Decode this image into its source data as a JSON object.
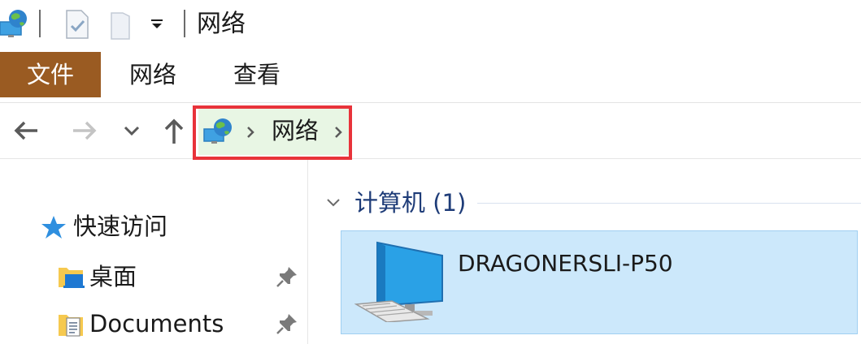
{
  "window": {
    "title": "网络"
  },
  "ribbon": {
    "tabs": [
      {
        "label": "文件"
      },
      {
        "label": "网络"
      },
      {
        "label": "查看"
      }
    ]
  },
  "address_bar": {
    "breadcrumbs": [
      "网络"
    ],
    "location_icon": "network-globe-icon"
  },
  "nav_pane": {
    "quick_access": {
      "label": "快速访问",
      "icon": "star-icon"
    },
    "items": [
      {
        "label": "桌面",
        "icon": "desktop-folder-icon",
        "pinned": true
      },
      {
        "label": "Documents",
        "icon": "documents-folder-icon",
        "pinned": true
      }
    ]
  },
  "content": {
    "group": {
      "label": "计算机 (1)",
      "expanded": true
    },
    "items": [
      {
        "name": "DRAGONERSLI-P50",
        "icon": "computer-monitor-icon",
        "selected": true
      }
    ]
  },
  "colors": {
    "file_tab": "#9a5b22",
    "selection": "#cce8fb",
    "group_label": "#1e3c78",
    "highlight_box": "#e8333a"
  }
}
